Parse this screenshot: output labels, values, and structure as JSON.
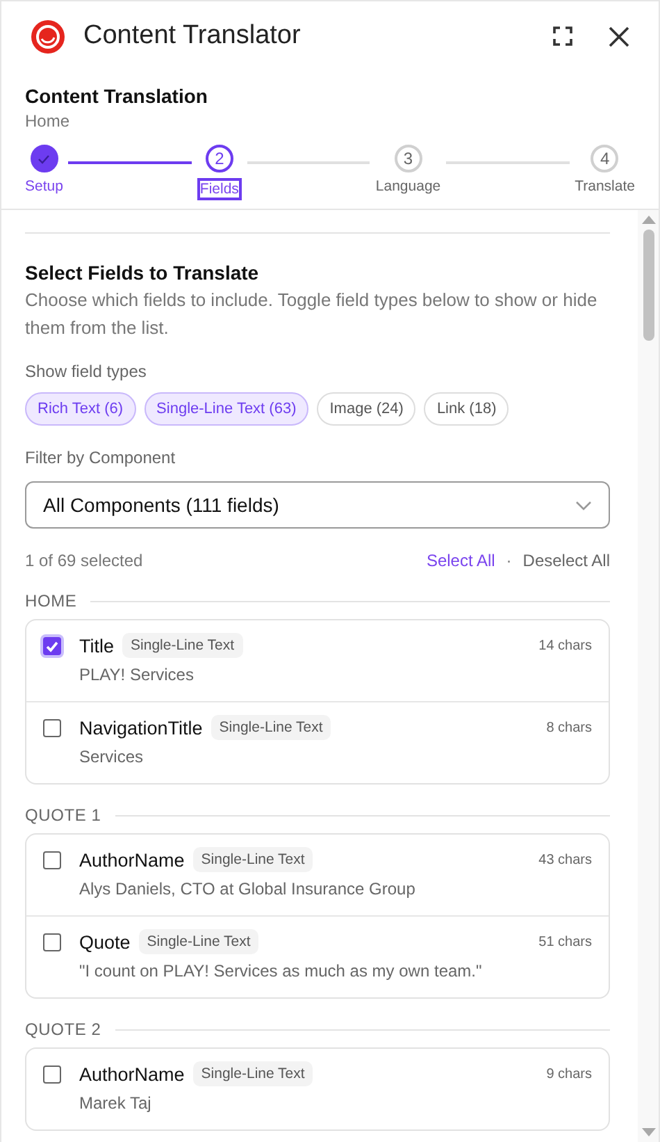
{
  "window": {
    "title": "Content Translator"
  },
  "header": {
    "title": "Content Translation",
    "subtitle": "Home"
  },
  "steps": [
    {
      "label": "Setup",
      "completed": true,
      "selected": false
    },
    {
      "label": "Fields",
      "number": "2",
      "completed": false,
      "selected": true
    },
    {
      "label": "Language",
      "number": "3",
      "completed": false,
      "selected": false
    },
    {
      "label": "Translate",
      "number": "4",
      "completed": false,
      "selected": false
    }
  ],
  "section": {
    "title": "Select Fields to Translate",
    "description": "Choose which fields to include. Toggle field types below to show or hide them from the list."
  },
  "field_types": {
    "label": "Show field types",
    "chips": [
      {
        "label": "Rich Text (6)",
        "selected": true
      },
      {
        "label": "Single-Line Text (63)",
        "selected": true
      },
      {
        "label": "Image (24)",
        "selected": false
      },
      {
        "label": "Link (18)",
        "selected": false
      }
    ]
  },
  "component_filter": {
    "label": "Filter by Component",
    "value": "All Components (111 fields)"
  },
  "selection": {
    "count": "1 of 69 selected",
    "select_all": "Select All",
    "separator": "·",
    "deselect_all": "Deselect All"
  },
  "groups": [
    {
      "name": "HOME",
      "fields": [
        {
          "name": "Title",
          "type": "Single-Line Text",
          "chars": "14 chars",
          "value": "PLAY! Services",
          "checked": true
        },
        {
          "name": "NavigationTitle",
          "type": "Single-Line Text",
          "chars": "8 chars",
          "value": "Services",
          "checked": false
        }
      ]
    },
    {
      "name": "QUOTE 1",
      "fields": [
        {
          "name": "AuthorName",
          "type": "Single-Line Text",
          "chars": "43 chars",
          "value": "Alys Daniels, CTO at Global Insurance Group",
          "checked": false
        },
        {
          "name": "Quote",
          "type": "Single-Line Text",
          "chars": "51 chars",
          "value": "\"I count on PLAY! Services as much as my own team.\"",
          "checked": false
        }
      ]
    },
    {
      "name": "QUOTE 2",
      "fields": [
        {
          "name": "AuthorName",
          "type": "Single-Line Text",
          "chars": "9 chars",
          "value": "Marek Taj",
          "checked": false
        }
      ]
    }
  ]
}
